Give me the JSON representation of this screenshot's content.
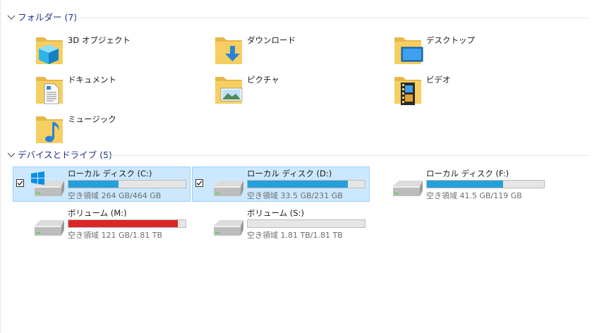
{
  "groups": {
    "folders": {
      "label": "フォルダー (7)"
    },
    "devices": {
      "label": "デバイスとドライブ (5)"
    }
  },
  "folders": [
    {
      "name": "3D オブジェクト",
      "icon": "3d-objects-icon"
    },
    {
      "name": "ダウンロード",
      "icon": "downloads-icon"
    },
    {
      "name": "デスクトップ",
      "icon": "desktop-icon"
    },
    {
      "name": "ドキュメント",
      "icon": "documents-icon"
    },
    {
      "name": "ピクチャ",
      "icon": "pictures-icon"
    },
    {
      "name": "ビデオ",
      "icon": "videos-icon"
    },
    {
      "name": "ミュージック",
      "icon": "music-icon"
    }
  ],
  "drives": [
    {
      "name": "ローカル ディスク (C:)",
      "free": "空き領域 264 GB/464 GB",
      "used_fraction": 0.43,
      "bar_color": "#26a0da",
      "selected": true,
      "checked": true,
      "windows_logo": true
    },
    {
      "name": "ローカル ディスク (D:)",
      "free": "空き領域 33.5 GB/231 GB",
      "used_fraction": 0.855,
      "bar_color": "#26a0da",
      "selected": true,
      "checked": true,
      "windows_logo": false
    },
    {
      "name": "ローカル ディスク (F:)",
      "free": "空き領域 41.5 GB/119 GB",
      "used_fraction": 0.65,
      "bar_color": "#26a0da",
      "selected": false,
      "checked": false,
      "windows_logo": false
    },
    {
      "name": "ボリューム (M:)",
      "free": "空き領域 121 GB/1.81 TB",
      "used_fraction": 0.935,
      "bar_color": "#da2626",
      "selected": false,
      "checked": false,
      "windows_logo": false
    },
    {
      "name": "ボリューム (S:)",
      "free": "空き領域 1.81 TB/1.81 TB",
      "used_fraction": 0.0,
      "bar_color": "#26a0da",
      "selected": false,
      "checked": false,
      "windows_logo": false
    }
  ],
  "colors": {
    "group_header": "#1e3287",
    "selection_bg": "#cce8ff",
    "selection_border": "#99d1ff",
    "bar_normal": "#26a0da",
    "bar_full": "#da2626"
  }
}
